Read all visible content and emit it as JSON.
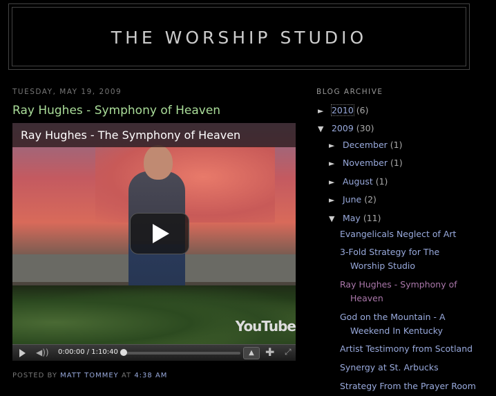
{
  "blog": {
    "title": "THE WORSHIP STUDIO"
  },
  "post": {
    "date": "TUESDAY, MAY 19, 2009",
    "title": "Ray Hughes - Symphony of Heaven",
    "video": {
      "title": "Ray Hughes - The Symphony of Heaven",
      "time": "0:00:00 / 1:10:40",
      "progress": 0,
      "logo": "YouTube",
      "icons": [
        "play-icon",
        "volume-icon",
        "expand-up-icon",
        "plus-icon",
        "fullscreen-icon"
      ]
    },
    "footer": {
      "prefix": "POSTED BY",
      "author": "MATT TOMMEY",
      "at": "AT",
      "time": "4:38 AM"
    }
  },
  "sidebar": {
    "title": "BLOG ARCHIVE",
    "years": [
      {
        "label": "2010",
        "count": "(6)",
        "toggle": "►"
      },
      {
        "label": "2009",
        "count": "(30)",
        "toggle": "▼"
      }
    ],
    "months": [
      {
        "label": "December",
        "count": "(1)",
        "toggle": "►"
      },
      {
        "label": "November",
        "count": "(1)",
        "toggle": "►"
      },
      {
        "label": "August",
        "count": "(1)",
        "toggle": "►"
      },
      {
        "label": "June",
        "count": "(2)",
        "toggle": "►"
      },
      {
        "label": "May",
        "count": "(11)",
        "toggle": "▼"
      }
    ],
    "posts": [
      {
        "line1": "Evangelicals Neglect of Art",
        "line2": ""
      },
      {
        "line1": "3-Fold Strategy for The",
        "line2": "Worship Studio"
      },
      {
        "line1": "Ray Hughes - Symphony of",
        "line2": "Heaven"
      },
      {
        "line1": "God on the Mountain - A",
        "line2": "Weekend In Kentucky"
      },
      {
        "line1": "Artist Testimony from Scotland",
        "line2": ""
      },
      {
        "line1": "Synergy at St. Arbucks",
        "line2": ""
      },
      {
        "line1": "Strategy From the Prayer Room",
        "line2": ""
      }
    ]
  },
  "colors": {
    "background": "#000000",
    "post_title": "#aadd99",
    "link": "#99aadd",
    "visited": "#aa77aa"
  }
}
